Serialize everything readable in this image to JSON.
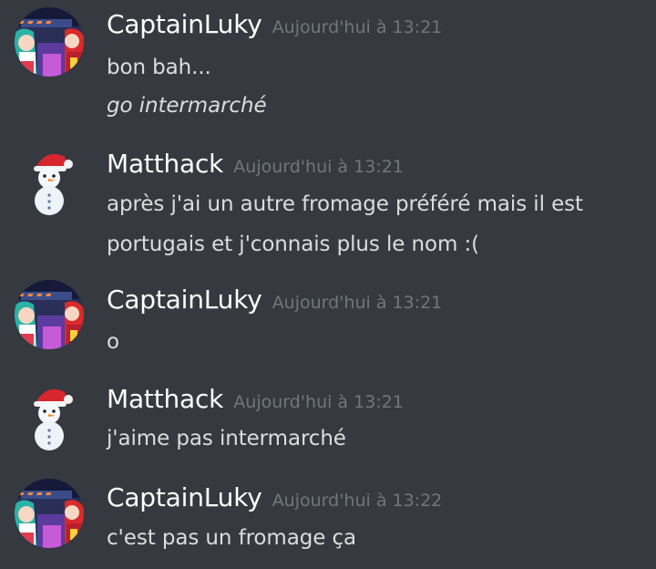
{
  "messages": [
    {
      "author": "CaptainLuky",
      "avatar_icon": "anime-characters-avatar",
      "timestamp": "Aujourd'hui à 13:21",
      "lines": [
        {
          "text": "bon bah...",
          "italic": false
        },
        {
          "text": "go intermarché",
          "italic": true
        }
      ]
    },
    {
      "author": "Matthack",
      "avatar_icon": "snowman-santa-hat-avatar",
      "timestamp": "Aujourd'hui à 13:21",
      "lines": [
        {
          "text": "après j'ai un autre fromage préféré mais il est",
          "italic": false
        },
        {
          "text": "portugais et j'connais plus le nom :(",
          "italic": false
        }
      ]
    },
    {
      "author": "CaptainLuky",
      "avatar_icon": "anime-characters-avatar",
      "timestamp": "Aujourd'hui à 13:21",
      "lines": [
        {
          "text": "o",
          "italic": false
        }
      ]
    },
    {
      "author": "Matthack",
      "avatar_icon": "snowman-santa-hat-avatar",
      "timestamp": "Aujourd'hui à 13:21",
      "lines": [
        {
          "text": "j'aime pas intermarché",
          "italic": false
        }
      ]
    },
    {
      "author": "CaptainLuky",
      "avatar_icon": "anime-characters-avatar",
      "timestamp": "Aujourd'hui à 13:22",
      "lines": [
        {
          "text": "c'est pas un fromage ça",
          "italic": false
        }
      ]
    }
  ],
  "colors": {
    "background": "#36393f",
    "username": "#ffffff",
    "timestamp": "#72767d",
    "message_text": "#dcddde"
  }
}
